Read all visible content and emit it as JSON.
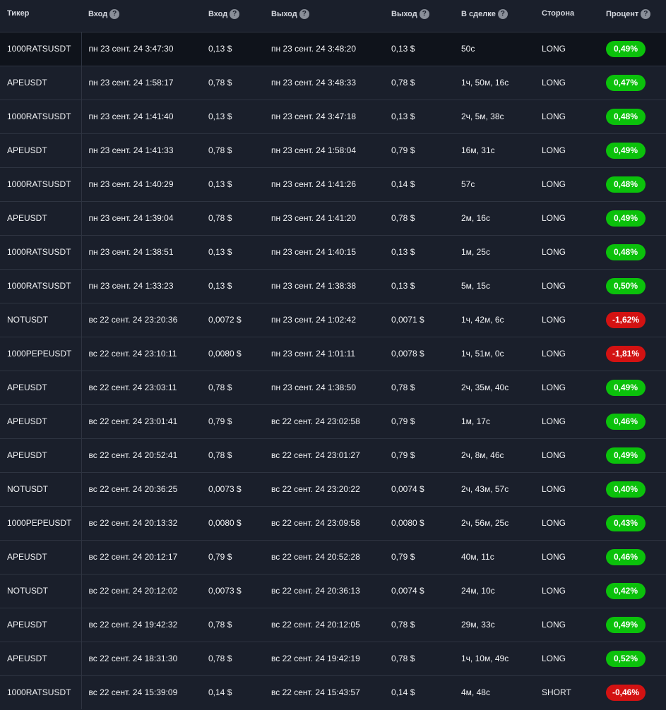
{
  "headers": {
    "ticker": "Тикер",
    "entry_time": "Вход",
    "entry_price": "Вход",
    "exit_time": "Выход",
    "exit_price": "Выход",
    "duration": "В сделке",
    "side": "Сторона",
    "percent": "Процент"
  },
  "colors": {
    "positive": "#0bc10b",
    "negative": "#d31212"
  },
  "rows": [
    {
      "ticker": "1000RATSUSDT",
      "entry_time": "пн 23 сент. 24 3:47:30",
      "entry_price": "0,13 $",
      "exit_time": "пн 23 сент. 24 3:48:20",
      "exit_price": "0,13 $",
      "duration": "50с",
      "side": "LONG",
      "percent": "0,49%",
      "sign": "pos"
    },
    {
      "ticker": "APEUSDT",
      "entry_time": "пн 23 сент. 24 1:58:17",
      "entry_price": "0,78 $",
      "exit_time": "пн 23 сент. 24 3:48:33",
      "exit_price": "0,78 $",
      "duration": "1ч, 50м, 16с",
      "side": "LONG",
      "percent": "0,47%",
      "sign": "pos"
    },
    {
      "ticker": "1000RATSUSDT",
      "entry_time": "пн 23 сент. 24 1:41:40",
      "entry_price": "0,13 $",
      "exit_time": "пн 23 сент. 24 3:47:18",
      "exit_price": "0,13 $",
      "duration": "2ч, 5м, 38с",
      "side": "LONG",
      "percent": "0,48%",
      "sign": "pos"
    },
    {
      "ticker": "APEUSDT",
      "entry_time": "пн 23 сент. 24 1:41:33",
      "entry_price": "0,78 $",
      "exit_time": "пн 23 сент. 24 1:58:04",
      "exit_price": "0,79 $",
      "duration": "16м, 31с",
      "side": "LONG",
      "percent": "0,49%",
      "sign": "pos"
    },
    {
      "ticker": "1000RATSUSDT",
      "entry_time": "пн 23 сент. 24 1:40:29",
      "entry_price": "0,13 $",
      "exit_time": "пн 23 сент. 24 1:41:26",
      "exit_price": "0,14 $",
      "duration": "57с",
      "side": "LONG",
      "percent": "0,48%",
      "sign": "pos"
    },
    {
      "ticker": "APEUSDT",
      "entry_time": "пн 23 сент. 24 1:39:04",
      "entry_price": "0,78 $",
      "exit_time": "пн 23 сент. 24 1:41:20",
      "exit_price": "0,78 $",
      "duration": "2м, 16с",
      "side": "LONG",
      "percent": "0,49%",
      "sign": "pos"
    },
    {
      "ticker": "1000RATSUSDT",
      "entry_time": "пн 23 сент. 24 1:38:51",
      "entry_price": "0,13 $",
      "exit_time": "пн 23 сент. 24 1:40:15",
      "exit_price": "0,13 $",
      "duration": "1м, 25с",
      "side": "LONG",
      "percent": "0,48%",
      "sign": "pos"
    },
    {
      "ticker": "1000RATSUSDT",
      "entry_time": "пн 23 сент. 24 1:33:23",
      "entry_price": "0,13 $",
      "exit_time": "пн 23 сент. 24 1:38:38",
      "exit_price": "0,13 $",
      "duration": "5м, 15с",
      "side": "LONG",
      "percent": "0,50%",
      "sign": "pos"
    },
    {
      "ticker": "NOTUSDT",
      "entry_time": "вс 22 сент. 24 23:20:36",
      "entry_price": "0,0072 $",
      "exit_time": "пн 23 сент. 24 1:02:42",
      "exit_price": "0,0071 $",
      "duration": "1ч, 42м, 6с",
      "side": "LONG",
      "percent": "-1,62%",
      "sign": "neg"
    },
    {
      "ticker": "1000PEPEUSDT",
      "entry_time": "вс 22 сент. 24 23:10:11",
      "entry_price": "0,0080 $",
      "exit_time": "пн 23 сент. 24 1:01:11",
      "exit_price": "0,0078 $",
      "duration": "1ч, 51м, 0с",
      "side": "LONG",
      "percent": "-1,81%",
      "sign": "neg"
    },
    {
      "ticker": "APEUSDT",
      "entry_time": "вс 22 сент. 24 23:03:11",
      "entry_price": "0,78 $",
      "exit_time": "пн 23 сент. 24 1:38:50",
      "exit_price": "0,78 $",
      "duration": "2ч, 35м, 40с",
      "side": "LONG",
      "percent": "0,49%",
      "sign": "pos"
    },
    {
      "ticker": "APEUSDT",
      "entry_time": "вс 22 сент. 24 23:01:41",
      "entry_price": "0,79 $",
      "exit_time": "вс 22 сент. 24 23:02:58",
      "exit_price": "0,79 $",
      "duration": "1м, 17с",
      "side": "LONG",
      "percent": "0,46%",
      "sign": "pos"
    },
    {
      "ticker": "APEUSDT",
      "entry_time": "вс 22 сент. 24 20:52:41",
      "entry_price": "0,78 $",
      "exit_time": "вс 22 сент. 24 23:01:27",
      "exit_price": "0,79 $",
      "duration": "2ч, 8м, 46с",
      "side": "LONG",
      "percent": "0,49%",
      "sign": "pos"
    },
    {
      "ticker": "NOTUSDT",
      "entry_time": "вс 22 сент. 24 20:36:25",
      "entry_price": "0,0073 $",
      "exit_time": "вс 22 сент. 24 23:20:22",
      "exit_price": "0,0074 $",
      "duration": "2ч, 43м, 57с",
      "side": "LONG",
      "percent": "0,40%",
      "sign": "pos"
    },
    {
      "ticker": "1000PEPEUSDT",
      "entry_time": "вс 22 сент. 24 20:13:32",
      "entry_price": "0,0080 $",
      "exit_time": "вс 22 сент. 24 23:09:58",
      "exit_price": "0,0080 $",
      "duration": "2ч, 56м, 25с",
      "side": "LONG",
      "percent": "0,43%",
      "sign": "pos"
    },
    {
      "ticker": "APEUSDT",
      "entry_time": "вс 22 сент. 24 20:12:17",
      "entry_price": "0,79 $",
      "exit_time": "вс 22 сент. 24 20:52:28",
      "exit_price": "0,79 $",
      "duration": "40м, 11с",
      "side": "LONG",
      "percent": "0,46%",
      "sign": "pos"
    },
    {
      "ticker": "NOTUSDT",
      "entry_time": "вс 22 сент. 24 20:12:02",
      "entry_price": "0,0073 $",
      "exit_time": "вс 22 сент. 24 20:36:13",
      "exit_price": "0,0074 $",
      "duration": "24м, 10с",
      "side": "LONG",
      "percent": "0,42%",
      "sign": "pos"
    },
    {
      "ticker": "APEUSDT",
      "entry_time": "вс 22 сент. 24 19:42:32",
      "entry_price": "0,78 $",
      "exit_time": "вс 22 сент. 24 20:12:05",
      "exit_price": "0,78 $",
      "duration": "29м, 33с",
      "side": "LONG",
      "percent": "0,49%",
      "sign": "pos"
    },
    {
      "ticker": "APEUSDT",
      "entry_time": "вс 22 сент. 24 18:31:30",
      "entry_price": "0,78 $",
      "exit_time": "вс 22 сент. 24 19:42:19",
      "exit_price": "0,78 $",
      "duration": "1ч, 10м, 49с",
      "side": "LONG",
      "percent": "0,52%",
      "sign": "pos"
    },
    {
      "ticker": "1000RATSUSDT",
      "entry_time": "вс 22 сент. 24 15:39:09",
      "entry_price": "0,14 $",
      "exit_time": "вс 22 сент. 24 15:43:57",
      "exit_price": "0,14 $",
      "duration": "4м, 48с",
      "side": "SHORT",
      "percent": "-0,46%",
      "sign": "neg"
    }
  ]
}
